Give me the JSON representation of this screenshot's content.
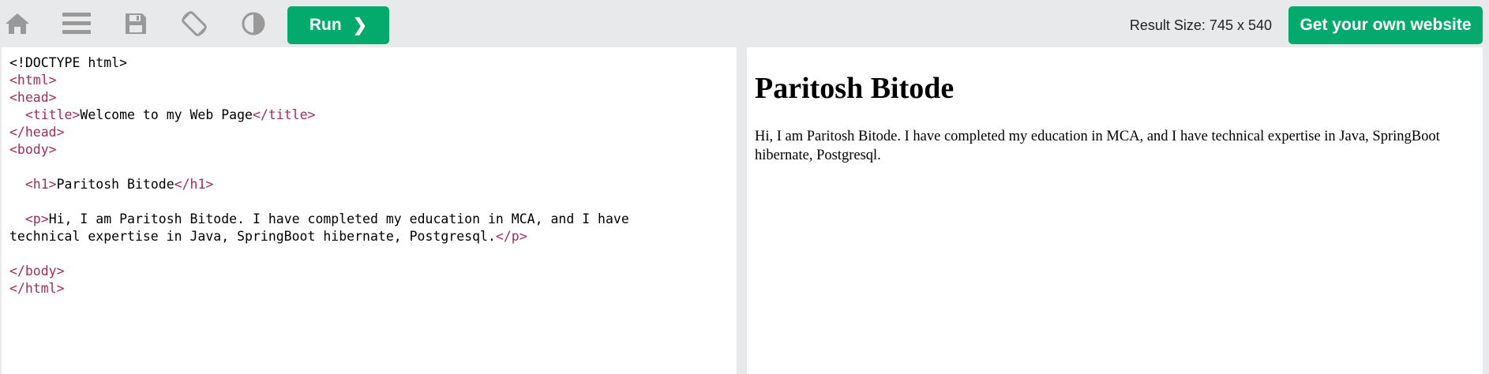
{
  "toolbar": {
    "icons": [
      "home-icon",
      "menu-icon",
      "save-icon",
      "rotate-icon",
      "contrast-icon"
    ],
    "run_label": "Run",
    "result_size": "Result Size: 745 x 540",
    "own_website_label": "Get your own website"
  },
  "editor": {
    "lines": [
      {
        "type": "text",
        "text": "<!DOCTYPE html>"
      },
      {
        "type": "tag",
        "text": "<html>"
      },
      {
        "type": "tag",
        "text": "<head>"
      },
      {
        "type": "element",
        "indent": "  ",
        "open": "<title>",
        "content": "Welcome to my Web Page",
        "close": "</title>"
      },
      {
        "type": "tag",
        "text": "</head>"
      },
      {
        "type": "tag",
        "text": "<body>"
      },
      {
        "type": "blank"
      },
      {
        "type": "element",
        "indent": "  ",
        "open": "<h1>",
        "content": "Paritosh Bitode",
        "close": "</h1>"
      },
      {
        "type": "blank"
      },
      {
        "type": "element",
        "indent": "  ",
        "open": "<p>",
        "content": "Hi, I am Paritosh Bitode. I have completed my education in MCA, and I have",
        "close": ""
      },
      {
        "type": "element",
        "indent": "",
        "open": "",
        "content": "technical expertise in Java, SpringBoot hibernate, Postgresql.",
        "close": "</p>"
      },
      {
        "type": "blank"
      },
      {
        "type": "tag",
        "text": "</body>"
      },
      {
        "type": "tag",
        "text": "</html>"
      }
    ]
  },
  "result": {
    "heading": "Paritosh Bitode",
    "paragraph": "Hi, I am Paritosh Bitode. I have completed my education in MCA, and I have technical expertise in Java, SpringBoot hibernate, Postgresql."
  },
  "colors": {
    "toolbar_bg": "#e7e9eb",
    "accent": "#04aa6d",
    "tag_color": "#a52a5a",
    "icon_gray": "#999999"
  }
}
